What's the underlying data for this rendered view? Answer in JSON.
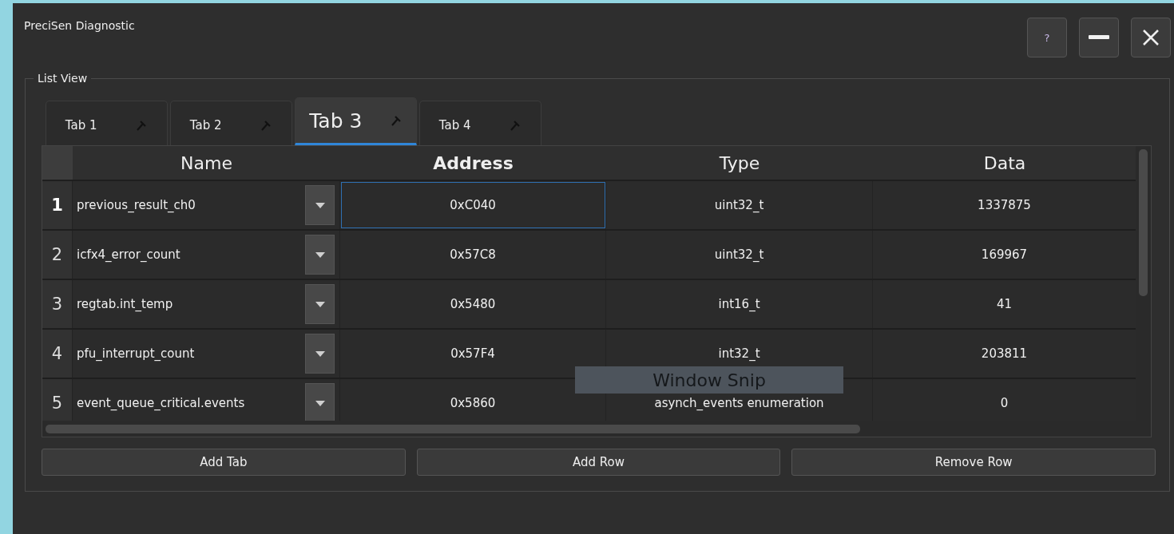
{
  "window": {
    "title": "PreciSen Diagnostic",
    "buttons": [
      {
        "kind": "help",
        "label": "?"
      },
      {
        "kind": "minimize"
      },
      {
        "kind": "close"
      }
    ]
  },
  "group": {
    "title": "List View"
  },
  "tabs": [
    {
      "label": "Tab 1",
      "selected": false
    },
    {
      "label": "Tab 2",
      "selected": false
    },
    {
      "label": "Tab 3",
      "selected": true
    },
    {
      "label": "Tab 4",
      "selected": false
    }
  ],
  "table": {
    "columns": [
      "Name",
      "Address",
      "Type",
      "Data"
    ],
    "rows": [
      {
        "number": "1",
        "name": "previous_result_ch0",
        "address": "0xC040",
        "type": "uint32_t",
        "data": "1337875",
        "current": true
      },
      {
        "number": "2",
        "name": "icfx4_error_count",
        "address": "0x57C8",
        "type": "uint32_t",
        "data": "169967",
        "current": false
      },
      {
        "number": "3",
        "name": "regtab.int_temp",
        "address": "0x5480",
        "type": "int16_t",
        "data": "41",
        "current": false
      },
      {
        "number": "4",
        "name": "pfu_interrupt_count",
        "address": "0x57F4",
        "type": "int32_t",
        "data": "203811",
        "current": false
      },
      {
        "number": "5",
        "name": "event_queue_critical.events",
        "address": "0x5860",
        "type": "asynch_events enumeration",
        "data": "0",
        "current": false
      }
    ]
  },
  "tooltip": "Window Snip",
  "actions": [
    "Add Tab",
    "Add Row",
    "Remove Row"
  ]
}
